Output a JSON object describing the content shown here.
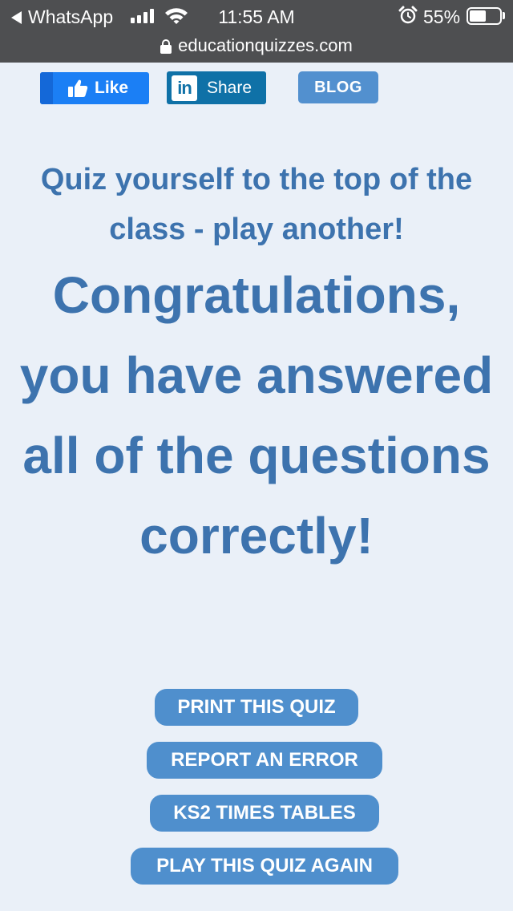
{
  "status_bar": {
    "back_app": "WhatsApp",
    "time": "11:55 AM",
    "battery_percent": "55%",
    "battery_level": 0.55,
    "signal_bars": 4,
    "icons": [
      "back-triangle-icon",
      "signal-icon",
      "wifi-icon",
      "alarm-clock-icon",
      "battery-icon"
    ]
  },
  "url_bar": {
    "domain": "educationquizzes.com",
    "icon": "lock-icon"
  },
  "social": {
    "like_label": "Like",
    "share_label": "Share",
    "linkedin_glyph": "in",
    "blog_label": "BLOG"
  },
  "content": {
    "tagline": "Quiz yourself to the top of the class - play another!",
    "congrats": "Congratulations, you have answered all of the questions correctly!"
  },
  "actions": {
    "print_quiz": "PRINT THIS QUIZ",
    "report_error": "REPORT AN ERROR",
    "ks2_times_tables": "KS2 TIMES TABLES",
    "play_again": "PLAY THIS QUIZ AGAIN"
  },
  "colors": {
    "status_bar_bg": "#4e4f51",
    "page_bg": "#eaf0f8",
    "heading_text": "#3d73ae",
    "facebook_blue": "#1b7ff5",
    "linkedin_blue": "#0f71a7",
    "button_blue": "#4f8fcd"
  }
}
